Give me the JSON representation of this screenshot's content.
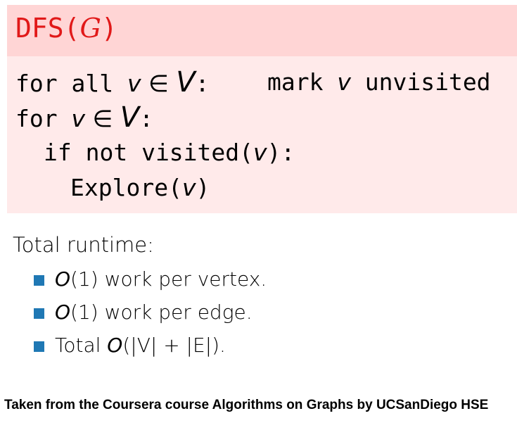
{
  "algorithm": {
    "title_name": "DFS(",
    "title_arg": "G",
    "title_close": ")",
    "line1": {
      "kw": "for all ",
      "var": "v",
      "rel": " ∈ ",
      "set": "V",
      "colon": ":",
      "action_kw": "mark ",
      "action_var": "v",
      "action_rest": " unvisited"
    },
    "line2": {
      "kw": "for ",
      "var": "v",
      "rel": " ∈ ",
      "set": "V",
      "colon": ":"
    },
    "line3": {
      "kw": "if not visited(",
      "var": "v",
      "close": "):"
    },
    "line4": {
      "kw": "Explore(",
      "var": "v",
      "close": ")"
    }
  },
  "runtime": {
    "heading": "Total runtime:",
    "items": [
      {
        "math": "O",
        "text_mid": "(1)",
        "text": " work per vertex."
      },
      {
        "math": "O",
        "text_mid": "(1)",
        "text": " work per edge."
      },
      {
        "prefix": "Total ",
        "math": "O",
        "text_mid": "(|V| + |E|)",
        "text": "."
      }
    ]
  },
  "caption": "Taken from the Coursera course Algorithms on Graphs by UCSanDiego HSE",
  "colors": {
    "header_bg": "#ffd5d5",
    "body_bg": "#ffeaea",
    "title_color": "#e11919",
    "bullet_color": "#1f78b4"
  }
}
